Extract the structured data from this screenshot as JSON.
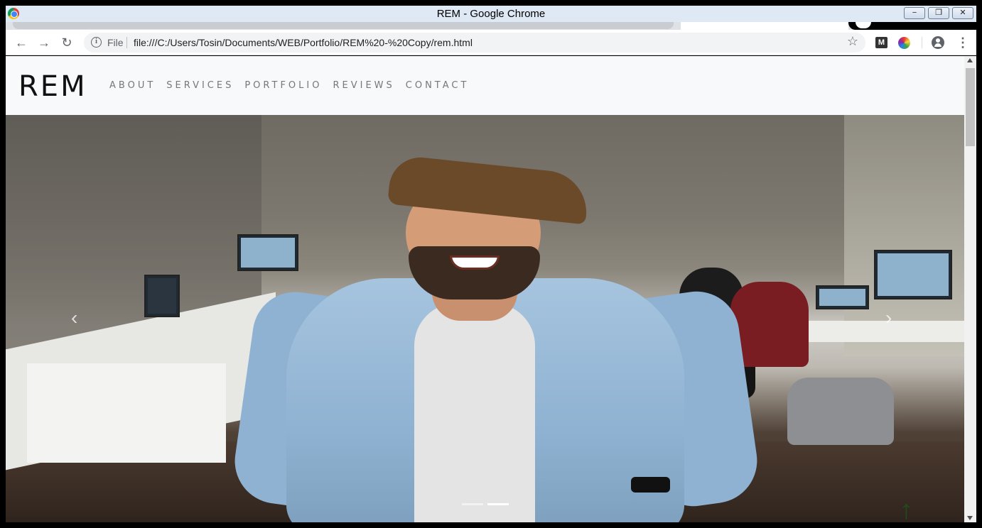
{
  "window": {
    "title": "REM - Google Chrome",
    "minimize": "−",
    "restore": "❐",
    "close": "✕"
  },
  "toolbar": {
    "back": "←",
    "forward": "→",
    "reload": "↻",
    "scheme": "File",
    "url": "file:///C:/Users/Tosin/Documents/WEB/Portfolio/REM%20-%20Copy/rem.html",
    "star": "☆",
    "extension_m": "M",
    "menu": "⋮"
  },
  "site": {
    "brand": "REM",
    "nav": [
      "ABOUT",
      "SERVICES",
      "PORTFOLIO",
      "REVIEWS",
      "CONTACT"
    ]
  },
  "carousel": {
    "prev": "‹",
    "next": "›",
    "slides": 2,
    "active_index": 1,
    "back_to_top": "↑"
  }
}
